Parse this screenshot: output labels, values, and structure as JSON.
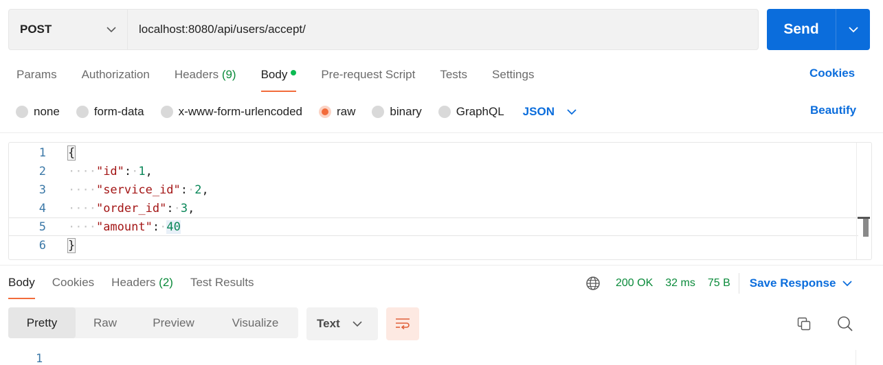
{
  "request": {
    "method": "POST",
    "url": "localhost:8080/api/users/accept/",
    "send_label": "Send"
  },
  "request_tabs": [
    {
      "label": "Params"
    },
    {
      "label": "Authorization"
    },
    {
      "label": "Headers",
      "count": "(9)"
    },
    {
      "label": "Body",
      "active": true
    },
    {
      "label": "Pre-request Script"
    },
    {
      "label": "Tests"
    },
    {
      "label": "Settings"
    }
  ],
  "cookies_label": "Cookies",
  "body_types": [
    "none",
    "form-data",
    "x-www-form-urlencoded",
    "raw",
    "binary",
    "GraphQL"
  ],
  "body_type_selected": "raw",
  "language": "JSON",
  "beautify_label": "Beautify",
  "editor": {
    "line_numbers": [
      "1",
      "2",
      "3",
      "4",
      "5",
      "6"
    ],
    "open_brace": "{",
    "close_brace": "}",
    "fields": [
      {
        "key": "\"id\"",
        "value": "1",
        "comma": ","
      },
      {
        "key": "\"service_id\"",
        "value": "2",
        "comma": ","
      },
      {
        "key": "\"order_id\"",
        "value": "3",
        "comma": ","
      },
      {
        "key": "\"amount\"",
        "value": "40",
        "comma": ""
      }
    ],
    "current_line": "5"
  },
  "response_tabs": [
    {
      "label": "Body",
      "active": true
    },
    {
      "label": "Cookies"
    },
    {
      "label": "Headers",
      "count": "(2)"
    },
    {
      "label": "Test Results"
    }
  ],
  "response_meta": {
    "status": "200 OK",
    "time": "32 ms",
    "size": "75 B",
    "save_label": "Save Response"
  },
  "view_modes": [
    "Pretty",
    "Raw",
    "Preview",
    "Visualize"
  ],
  "view_mode_active": "Pretty",
  "response_format": "Text",
  "response_line_numbers": [
    "1"
  ],
  "colors": {
    "accent_blue": "#0b6ddc",
    "accent_orange": "#f26b3a",
    "status_green": "#0a8a3a"
  },
  "icons": [
    "chevron-down-icon",
    "globe-icon",
    "wrap-lines-icon",
    "copy-icon",
    "search-icon"
  ]
}
